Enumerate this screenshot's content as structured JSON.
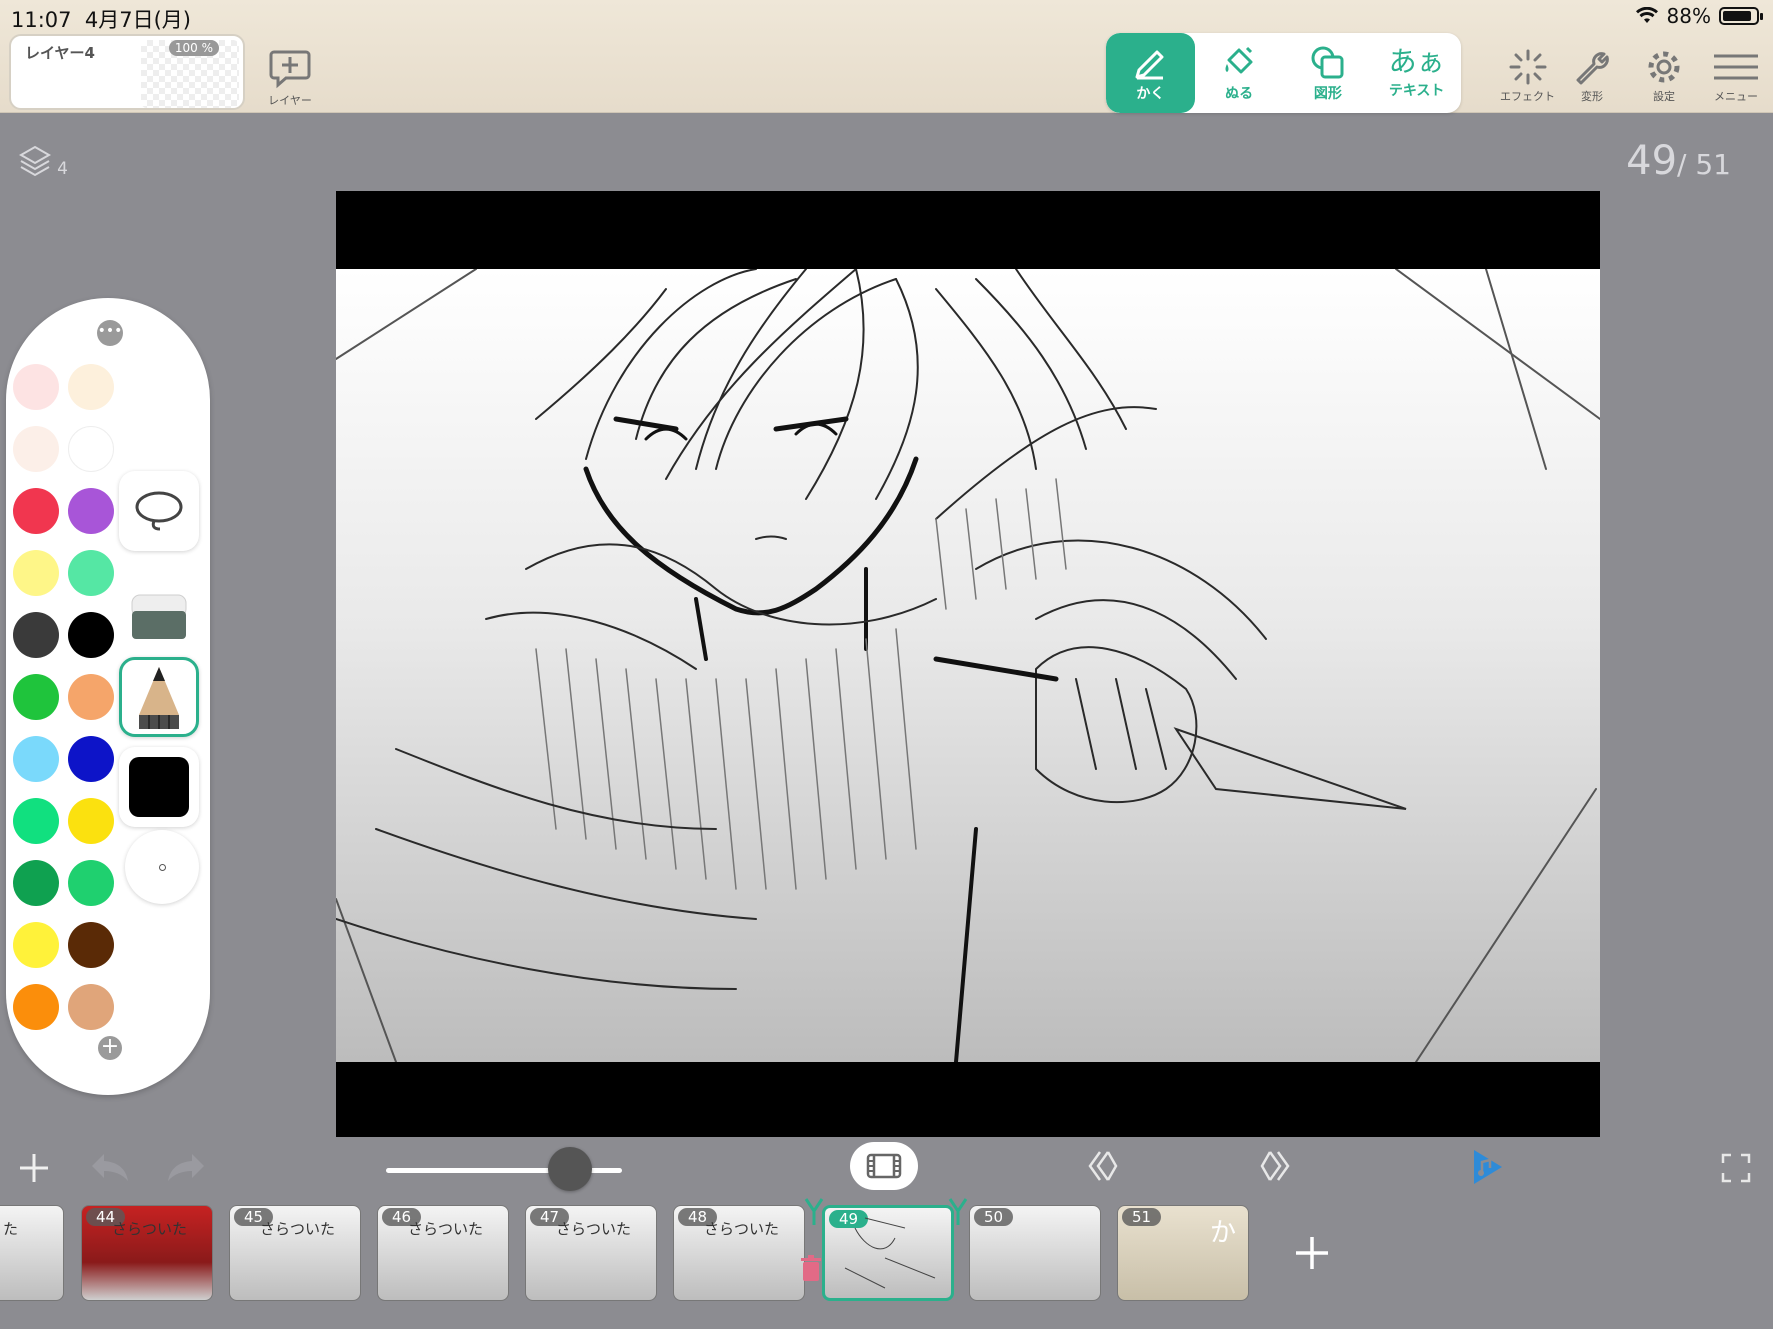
{
  "status_bar": {
    "time": "11:07",
    "date": "4月7日(月)",
    "battery": "88%",
    "battery_level": 0.88
  },
  "layer_card": {
    "name": "レイヤー4",
    "opacity": "100 %"
  },
  "toolbar": {
    "add_layer_label": "レイヤー",
    "modes": [
      {
        "label": "かく",
        "icon": "pencil-icon",
        "active": true
      },
      {
        "label": "ぬる",
        "icon": "bucket-icon",
        "active": false
      },
      {
        "label": "図形",
        "icon": "shape-icon",
        "active": false
      },
      {
        "label": "テキスト",
        "icon": "text-icon",
        "glyph": "あぁ",
        "active": false
      }
    ],
    "right_tools": [
      {
        "label": "エフェクト",
        "icon": "sparkle-icon"
      },
      {
        "label": "変形",
        "icon": "wrench-icon"
      },
      {
        "label": "設定",
        "icon": "gear-icon"
      },
      {
        "label": "メニュー",
        "icon": "hamburger-icon"
      }
    ]
  },
  "canvas": {
    "layers_count": "4",
    "current_frame": "49",
    "total_frames": "/ 51"
  },
  "palette": {
    "colors": [
      "#fde3e3",
      "#fdf0dc",
      "#fcefe8",
      "#ffffff",
      "#f1364f",
      "#a855d8",
      "#fef688",
      "#55e7a4",
      "#3a3a3a",
      "#000000",
      "#1fc43c",
      "#f5a56a",
      "#7ad9fb",
      "#0d14c8",
      "#11e07f",
      "#fbe10f",
      "#0fa150",
      "#1fd06f",
      "#fff23a",
      "#5a2a06",
      "#fb8e0b",
      "#e0a57a"
    ],
    "current_color": "#000000",
    "tools": [
      "lasso-icon",
      "eraser-icon",
      "pencil-tool-icon",
      "current-color-swatch",
      "brush-size-indicator"
    ]
  },
  "timeline": {
    "frames": [
      {
        "num": "",
        "caption": "た"
      },
      {
        "num": "44",
        "caption": "さらついた"
      },
      {
        "num": "45",
        "caption": "さらついた"
      },
      {
        "num": "46",
        "caption": "さらついた"
      },
      {
        "num": "47",
        "caption": "さらついた"
      },
      {
        "num": "48",
        "caption": "さらついた"
      },
      {
        "num": "49",
        "caption": ""
      },
      {
        "num": "50",
        "caption": ""
      },
      {
        "num": "51",
        "caption": "か"
      }
    ],
    "slider_value": 0.78
  },
  "theme": {
    "accent": "#2bb08c",
    "play": "#2e8bd8"
  }
}
